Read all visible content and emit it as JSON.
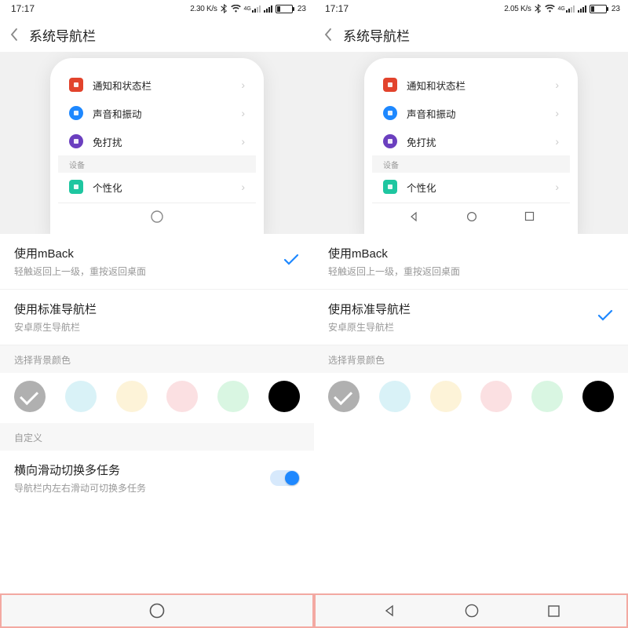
{
  "panes": [
    {
      "status": {
        "time": "17:17",
        "speed": "2.30 K/s",
        "battery": "23"
      },
      "title": "系统导航栏",
      "preview_rows": [
        {
          "label": "通知和状态栏",
          "icon_name": "notification-icon",
          "bg": "#e2432c",
          "shape": "rect"
        },
        {
          "label": "声音和振动",
          "icon_name": "sound-icon",
          "bg": "#1e88ff",
          "shape": "circle"
        },
        {
          "label": "免打扰",
          "icon_name": "dnd-icon",
          "bg": "#6b3fbf",
          "shape": "circle"
        }
      ],
      "preview_section": "设备",
      "preview_last_row": {
        "label": "个性化",
        "icon_name": "personalization-icon",
        "bg": "#1ec6a0",
        "shape": "rect"
      },
      "preview_nav_mode": "mback",
      "options": [
        {
          "title": "使用mBack",
          "desc": "轻触返回上一级，重按返回桌面",
          "selected": true
        },
        {
          "title": "使用标准导航栏",
          "desc": "安卓原生导航栏",
          "selected": false
        }
      ],
      "section_bg_label": "选择背景颜色",
      "swatches": [
        {
          "color": "#b0b0b0",
          "selected": true
        },
        {
          "color": "#d9f2f7",
          "selected": false
        },
        {
          "color": "#fdf3d8",
          "selected": false
        },
        {
          "color": "#fbe0e2",
          "selected": false
        },
        {
          "color": "#d9f6e2",
          "selected": false
        },
        {
          "color": "#000000",
          "selected": false
        }
      ],
      "section_custom_label": "自定义",
      "switch_row": {
        "title": "横向滑动切换多任务",
        "desc": "导航栏内左右滑动可切换多任务",
        "on": true
      },
      "bottom_nav_mode": "mback"
    },
    {
      "status": {
        "time": "17:17",
        "speed": "2.05 K/s",
        "battery": "23"
      },
      "title": "系统导航栏",
      "preview_rows": [
        {
          "label": "通知和状态栏",
          "icon_name": "notification-icon",
          "bg": "#e2432c",
          "shape": "rect"
        },
        {
          "label": "声音和振动",
          "icon_name": "sound-icon",
          "bg": "#1e88ff",
          "shape": "circle"
        },
        {
          "label": "免打扰",
          "icon_name": "dnd-icon",
          "bg": "#6b3fbf",
          "shape": "circle"
        }
      ],
      "preview_section": "设备",
      "preview_last_row": {
        "label": "个性化",
        "icon_name": "personalization-icon",
        "bg": "#1ec6a0",
        "shape": "rect"
      },
      "preview_nav_mode": "standard",
      "options": [
        {
          "title": "使用mBack",
          "desc": "轻触返回上一级，重按返回桌面",
          "selected": false
        },
        {
          "title": "使用标准导航栏",
          "desc": "安卓原生导航栏",
          "selected": true
        }
      ],
      "section_bg_label": "选择背景颜色",
      "swatches": [
        {
          "color": "#b0b0b0",
          "selected": true
        },
        {
          "color": "#d9f2f7",
          "selected": false
        },
        {
          "color": "#fdf3d8",
          "selected": false
        },
        {
          "color": "#fbe0e2",
          "selected": false
        },
        {
          "color": "#d9f6e2",
          "selected": false
        },
        {
          "color": "#000000",
          "selected": false
        }
      ],
      "section_custom_label": null,
      "switch_row": null,
      "bottom_nav_mode": "standard"
    }
  ]
}
